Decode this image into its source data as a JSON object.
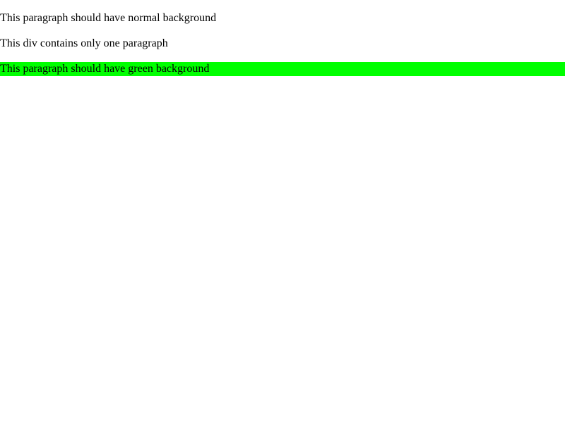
{
  "paragraphs": {
    "normal": "This paragraph should have normal background",
    "div_only": "This div contains only one paragraph",
    "green": "This paragraph should have green background"
  },
  "colors": {
    "page_background": "#ffffff",
    "text": "#000000",
    "green_highlight": "#00ff00"
  }
}
